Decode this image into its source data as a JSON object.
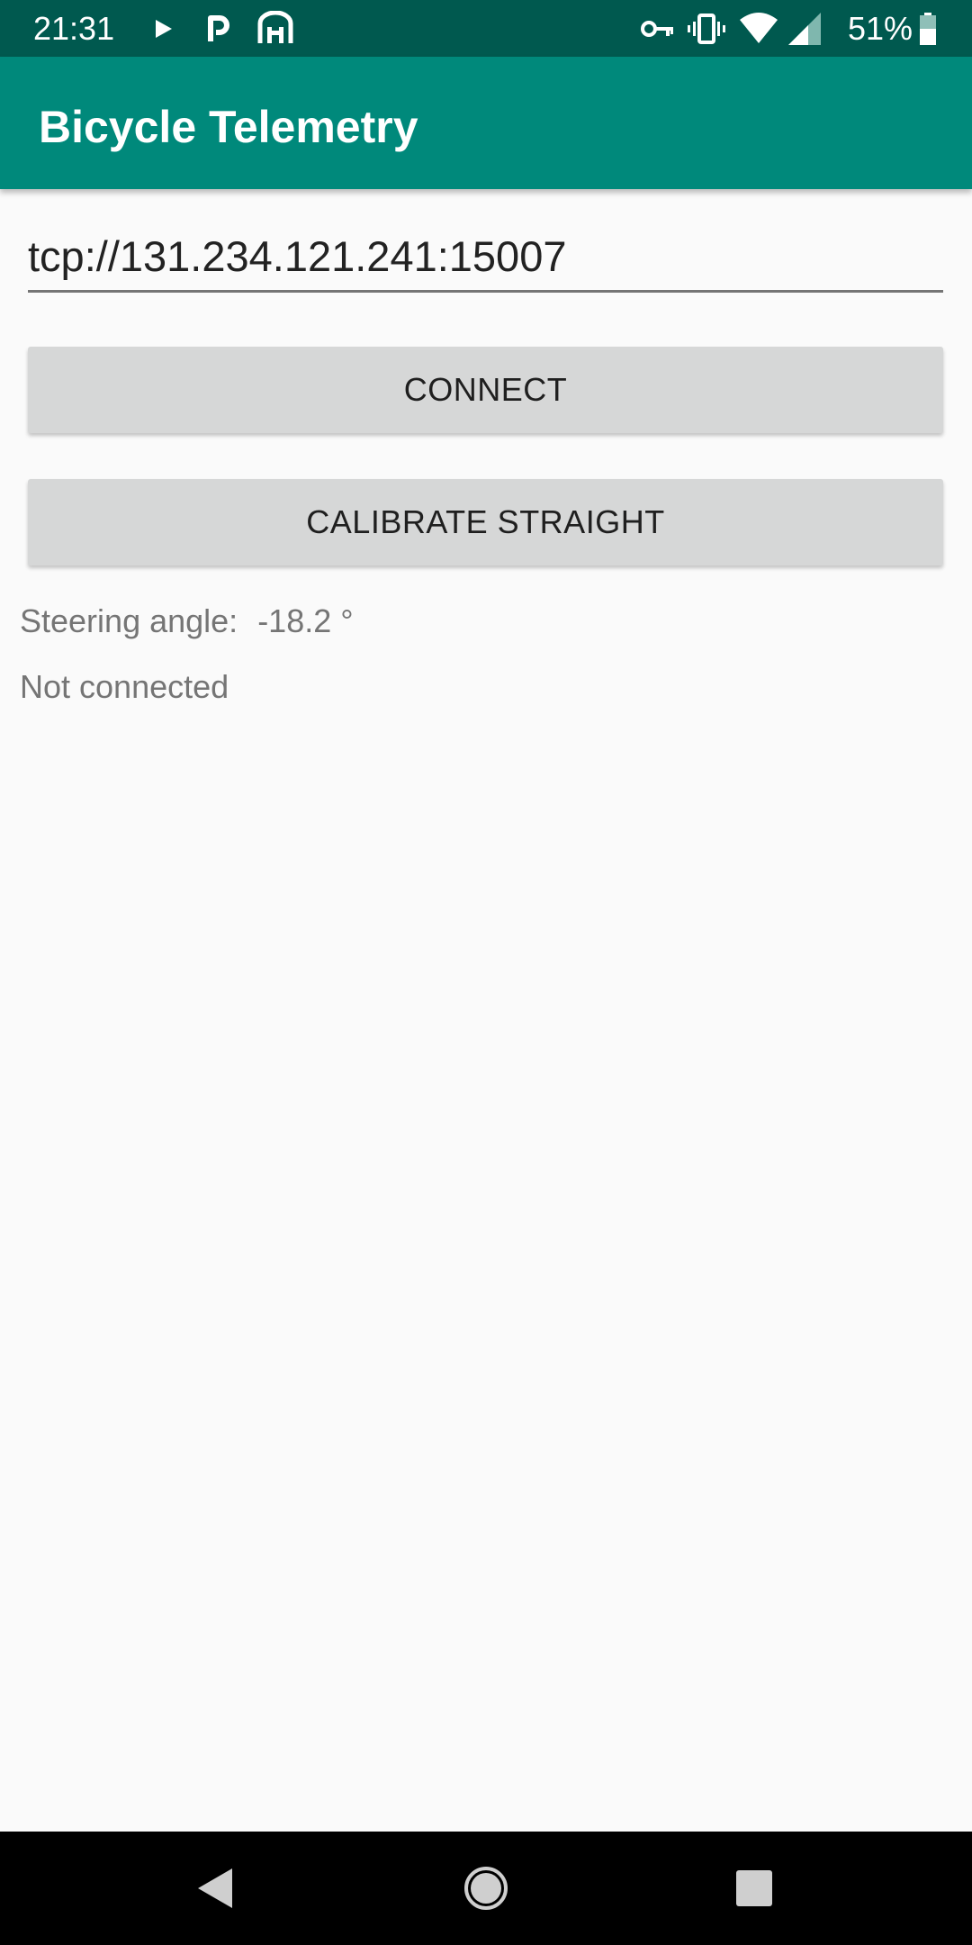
{
  "status_bar": {
    "time": "21:31",
    "icons_left": [
      "play-icon",
      "parking-icon",
      "gate-icon"
    ],
    "icons_right": [
      "vpn-key-icon",
      "vibrate-icon",
      "wifi-icon",
      "signal-icon",
      "battery-icon"
    ],
    "battery_text": "51%"
  },
  "app_bar": {
    "title": "Bicycle Telemetry"
  },
  "address": {
    "value": "tcp://131.234.121.241:15007"
  },
  "buttons": {
    "connect": "CONNECT",
    "calibrate": "CALIBRATE STRAIGHT"
  },
  "steering": {
    "label": "Steering angle:",
    "value": "-18.2 °"
  },
  "connection_status": "Not connected",
  "nav_bar": {
    "icons": [
      "back-icon",
      "home-icon",
      "recents-icon"
    ]
  },
  "colors": {
    "status_bar": "#00594f",
    "app_bar": "#00897b",
    "button": "#d6d7d7",
    "background": "#fafafa"
  }
}
